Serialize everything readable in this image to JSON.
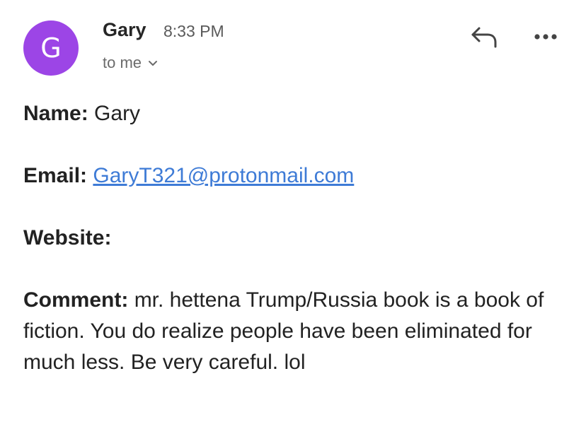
{
  "header": {
    "avatar_letter": "G",
    "avatar_color": "#9c45e6",
    "sender": "Gary",
    "time": "8:33 PM",
    "recipient": "to me"
  },
  "actions": {
    "reply_icon": "reply-arrow-icon",
    "more_icon": "more-horizontal-icon"
  },
  "message": {
    "name_label": "Name:",
    "name_value": "Gary",
    "email_label": "Email:",
    "email_value": "GaryT321@protonmail.com",
    "website_label": "Website:",
    "comment_label": "Comment:",
    "comment_value": "mr. hettena Trump/Russia book is a book of fiction. You do realize people have been eliminated for much less. Be very careful. lol"
  },
  "colors": {
    "link": "#3e7bd6"
  }
}
